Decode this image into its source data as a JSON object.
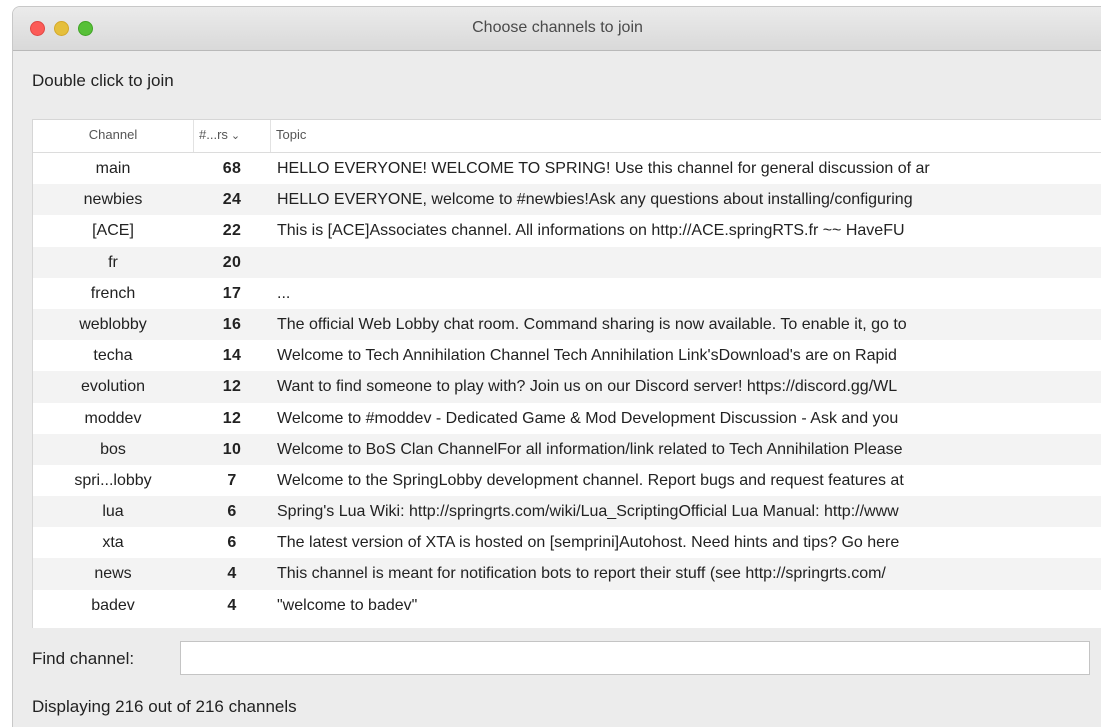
{
  "window": {
    "title": "Choose channels to join"
  },
  "hint": "Double click to join",
  "table": {
    "headers": {
      "channel": "Channel",
      "users": "#...rs",
      "sort_glyph": "⌄",
      "topic": "Topic"
    },
    "rows": [
      {
        "channel": "main",
        "users": "68",
        "topic": "HELLO EVERYONE! WELCOME TO SPRING! Use this channel for general discussion of ar"
      },
      {
        "channel": "newbies",
        "users": "24",
        "topic": "HELLO EVERYONE, welcome to #newbies!Ask any questions about installing/configuring"
      },
      {
        "channel": "[ACE]",
        "users": "22",
        "topic": "This is [ACE]Associates channel. All informations on http://ACE.springRTS.fr  ~~ HaveFU"
      },
      {
        "channel": "fr",
        "users": "20",
        "topic": ""
      },
      {
        "channel": "french",
        "users": "17",
        "topic": "..."
      },
      {
        "channel": "weblobby",
        "users": "16",
        "topic": "The official Web Lobby chat room. Command sharing is now available. To enable it, go to"
      },
      {
        "channel": "techa",
        "users": "14",
        "topic": "Welcome to Tech Annihilation Channel Tech Annihilation Link'sDownload's are on Rapid"
      },
      {
        "channel": "evolution",
        "users": "12",
        "topic": "Want to find someone to play with? Join us on our Discord server! https://discord.gg/WL"
      },
      {
        "channel": "moddev",
        "users": "12",
        "topic": "Welcome to #moddev - Dedicated Game & Mod Development Discussion - Ask and you"
      },
      {
        "channel": "bos",
        "users": "10",
        "topic": "Welcome to BoS Clan ChannelFor all information/link related to Tech Annihilation Please"
      },
      {
        "channel": "spri...lobby",
        "users": "7",
        "topic": "Welcome to the SpringLobby development channel. Report bugs and request features at"
      },
      {
        "channel": "lua",
        "users": "6",
        "topic": "Spring's Lua Wiki: http://springrts.com/wiki/Lua_ScriptingOfficial Lua Manual: http://www"
      },
      {
        "channel": "xta",
        "users": "6",
        "topic": "The latest version of XTA is hosted on [semprini]Autohost. Need hints and tips? Go here"
      },
      {
        "channel": "news",
        "users": "4",
        "topic": "This channel is meant for notification bots to report their stuff (see http://springrts.com/"
      },
      {
        "channel": "badev",
        "users": "4",
        "topic": "\"welcome to badev\""
      }
    ]
  },
  "find": {
    "label": "Find channel:",
    "value": "",
    "placeholder": ""
  },
  "status": "Displaying 216 out of 216 channels"
}
